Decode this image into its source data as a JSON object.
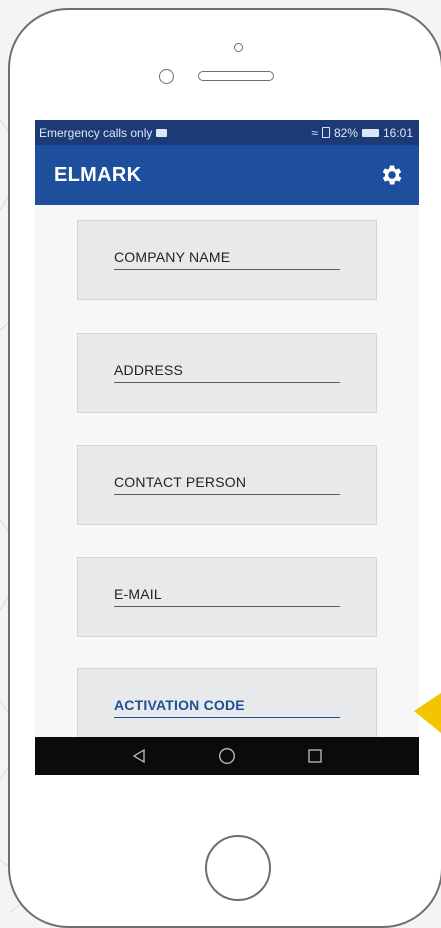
{
  "status_bar": {
    "carrier_text": "Emergency calls only",
    "battery_percent": "82%",
    "time": "16:01"
  },
  "app_bar": {
    "title": "ELMARK",
    "settings_icon": "gear-icon"
  },
  "form": {
    "fields": [
      {
        "label": "COMPANY NAME",
        "active": false
      },
      {
        "label": "ADDRESS",
        "active": false
      },
      {
        "label": "CONTACT PERSON",
        "active": false
      },
      {
        "label": "E-MAIL",
        "active": false
      },
      {
        "label": "ACTIVATION CODE",
        "active": true
      }
    ]
  },
  "nav_bar": {
    "buttons": [
      "back-icon",
      "home-circle-icon",
      "recents-square-icon"
    ]
  },
  "colors": {
    "status_bar": "#1c3b76",
    "app_bar": "#1e4f9c",
    "accent": "#1e4f9c",
    "pointer": "#f5c400"
  }
}
